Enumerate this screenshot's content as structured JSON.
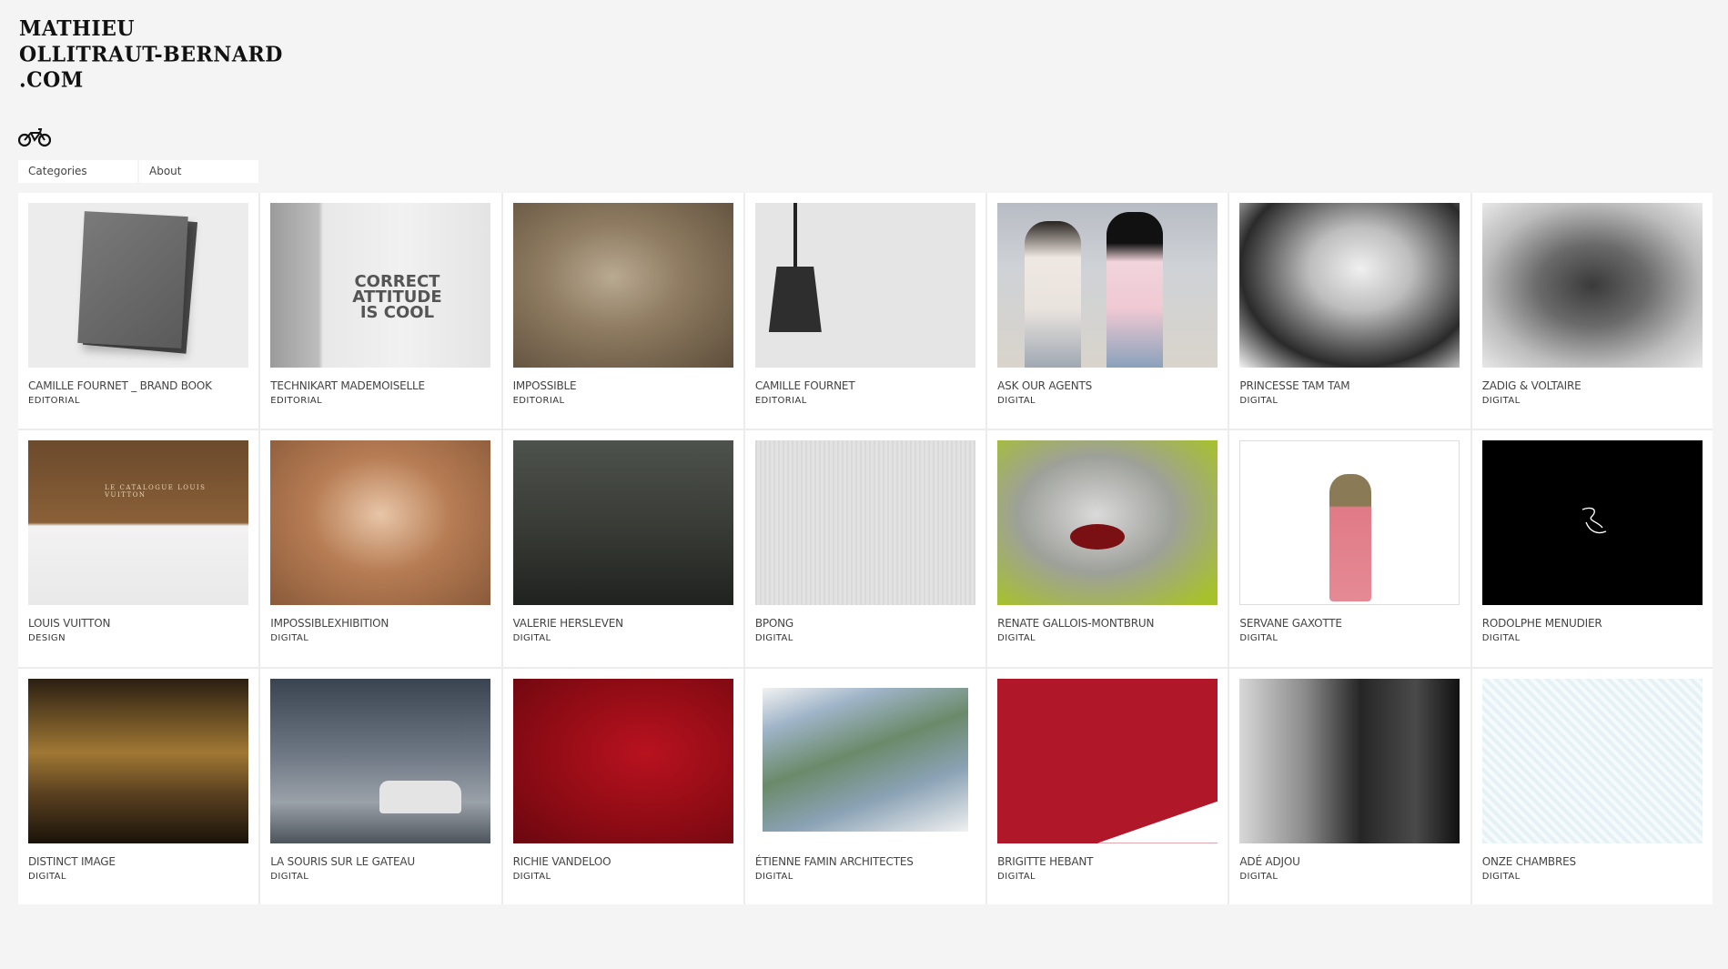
{
  "logo": {
    "line1": "MATHIEU",
    "line2": "OLLITRAUT-BERNARD",
    "line3": ".COM"
  },
  "icons": {
    "home": "motorbike-icon"
  },
  "nav": {
    "categories": "Categories",
    "about": "About"
  },
  "projects": [
    {
      "title": "CAMILLE FOURNET _ BRAND BOOK",
      "category": "EDITORIAL"
    },
    {
      "title": "TECHNIKART MADEMOISELLE",
      "category": "EDITORIAL",
      "thumb_text": [
        "CORRECT",
        "ATTITUDE",
        "IS COOL"
      ]
    },
    {
      "title": "IMPOSSIBLE",
      "category": "EDITORIAL"
    },
    {
      "title": "CAMILLE FOURNET",
      "category": "EDITORIAL"
    },
    {
      "title": "ASK OUR AGENTS",
      "category": "DIGITAL"
    },
    {
      "title": "PRINCESSE TAM TAM",
      "category": "DIGITAL"
    },
    {
      "title": "ZADIG & VOLTAIRE",
      "category": "DIGITAL"
    },
    {
      "title": "LOUIS VUITTON",
      "category": "DESIGN",
      "thumb_text": [
        "LE CATALOGUE LOUIS VUITTON"
      ]
    },
    {
      "title": "IMPOSSIBLEXHIBITION",
      "category": "DIGITAL"
    },
    {
      "title": "VALERIE HERSLEVEN",
      "category": "DIGITAL"
    },
    {
      "title": "BPONG",
      "category": "DIGITAL"
    },
    {
      "title": "RENATE GALLOIS-MONTBRUN",
      "category": "DIGITAL"
    },
    {
      "title": "SERVANE GAXOTTE",
      "category": "DIGITAL"
    },
    {
      "title": "RODOLPHE MENUDIER",
      "category": "DIGITAL"
    },
    {
      "title": "DISTINCT IMAGE",
      "category": "DIGITAL"
    },
    {
      "title": "LA SOURIS SUR LE GATEAU",
      "category": "DIGITAL"
    },
    {
      "title": "RICHIE VANDELOO",
      "category": "DIGITAL"
    },
    {
      "title": "ÉTIENNE FAMIN ARCHITECTES",
      "category": "DIGITAL"
    },
    {
      "title": "BRIGITTE HEBANT",
      "category": "DIGITAL"
    },
    {
      "title": "ADÉ ADJOU",
      "category": "DIGITAL"
    },
    {
      "title": "ONZE CHAMBRES",
      "category": "DIGITAL"
    }
  ]
}
